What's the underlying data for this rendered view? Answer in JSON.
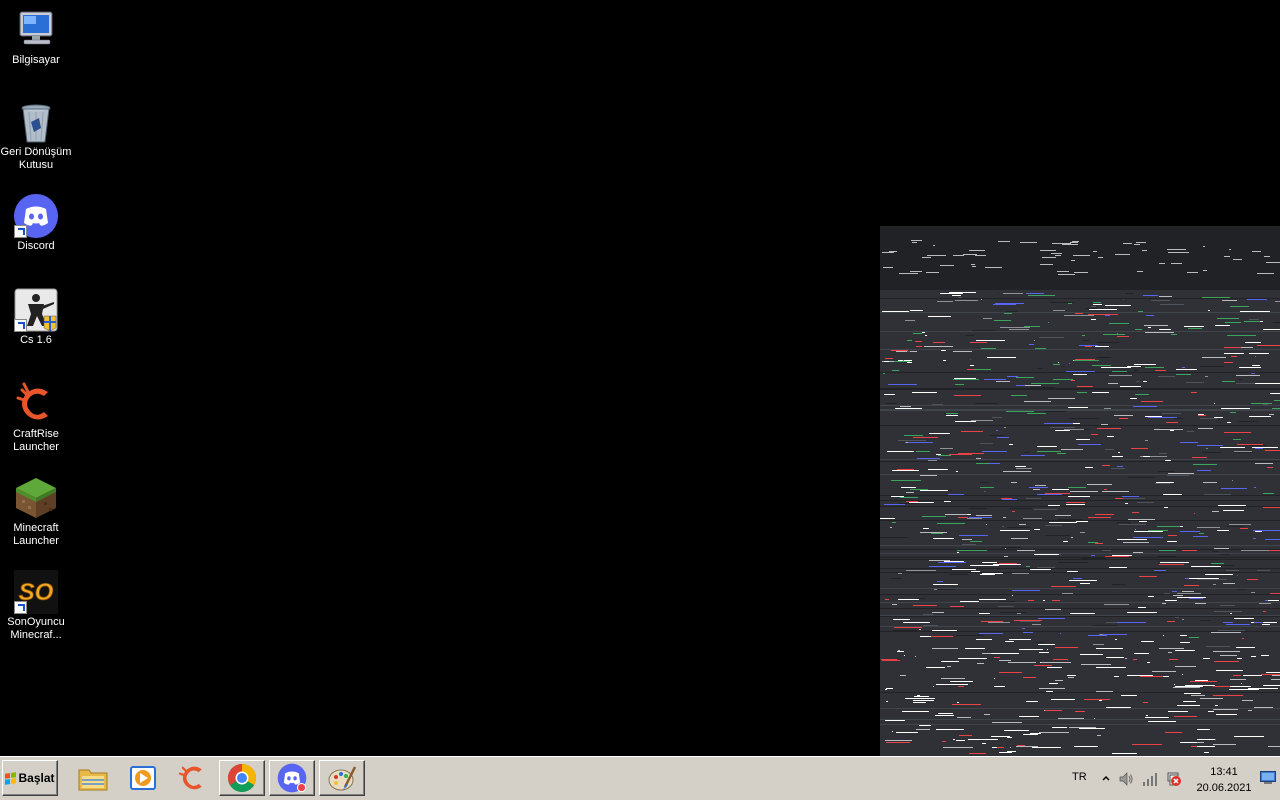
{
  "desktop": {
    "icons": [
      {
        "label": "Bilgisayar",
        "icon": "computer-icon"
      },
      {
        "label": "Geri Dönüşüm Kutusu",
        "icon": "recycle-bin-icon"
      },
      {
        "label": "Discord",
        "icon": "discord-icon",
        "shortcut": true
      },
      {
        "label": "Cs 1.6",
        "icon": "counter-strike-icon",
        "shortcut": true
      },
      {
        "label": "CraftRise Launcher",
        "icon": "craftrise-icon"
      },
      {
        "label": "Minecraft Launcher",
        "icon": "minecraft-icon"
      },
      {
        "label": "SonOyuncu Minecraf...",
        "icon": "sonoyuncu-icon",
        "shortcut": true
      }
    ]
  },
  "taskbar": {
    "start_label": "Başlat",
    "pinned": [
      {
        "icon": "file-explorer-icon"
      },
      {
        "icon": "media-player-icon"
      },
      {
        "icon": "craftrise-icon"
      },
      {
        "icon": "chrome-icon"
      },
      {
        "icon": "discord-icon"
      },
      {
        "icon": "paint-icon"
      }
    ],
    "tray": {
      "language": "TR",
      "time": "13:41",
      "date": "20.06.2021"
    }
  },
  "colors": {
    "taskbar_bg": "#d4d0c8",
    "desktop_bg": "#000000",
    "discord_blurple": "#5865f2",
    "glitch_bg": "#2f3136"
  }
}
